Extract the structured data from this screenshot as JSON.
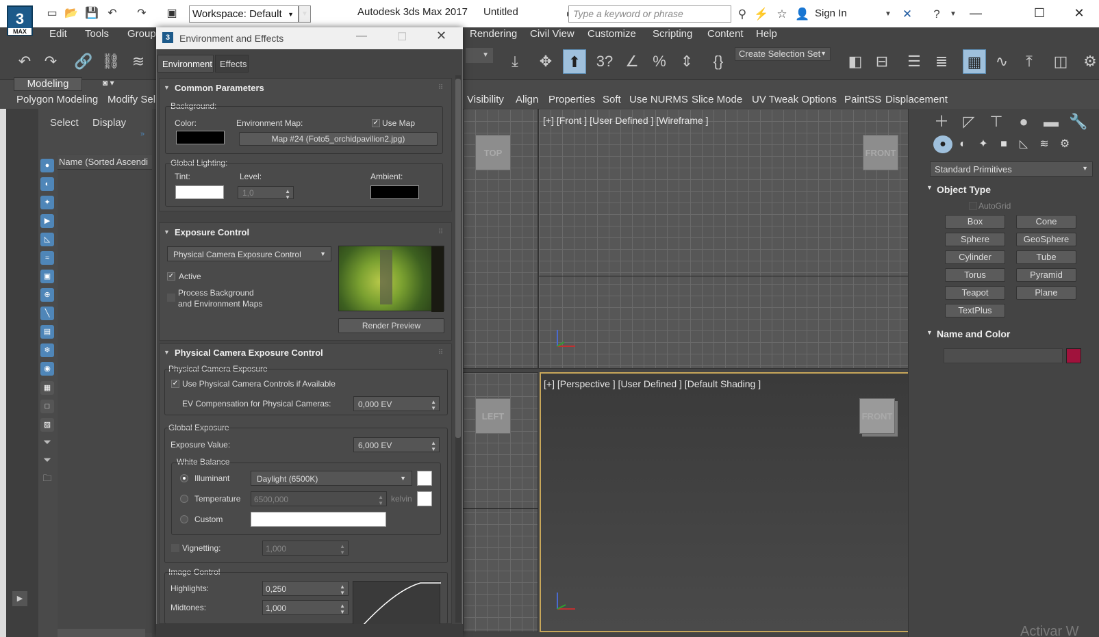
{
  "title_bar": {
    "app_logo": "3",
    "app_logo_sub": "MAX",
    "workspace": "Workspace: Default",
    "app_title": "Autodesk 3ds Max 2017",
    "doc_title": "Untitled",
    "search_placeholder": "Type a keyword or phrase",
    "sign_in": "Sign In"
  },
  "menus": [
    "Edit",
    "Tools",
    "Group",
    "Rendering",
    "Civil View",
    "Customize",
    "Scripting",
    "Content",
    "Help"
  ],
  "toolbar": {
    "selection_set": "Create Selection Set"
  },
  "ribbon": {
    "tab": "Modeling",
    "left_items": [
      "Polygon Modeling",
      "Modify Sel"
    ],
    "right_items": [
      "Visibility",
      "Align",
      "Properties",
      "Soft",
      "Use NURMS",
      "Slice Mode",
      "UV Tweak Options",
      "PaintSS",
      "Displacement"
    ]
  },
  "scene_explorer": {
    "tabs": [
      "Select",
      "Display"
    ],
    "column": "Name (Sorted Ascendi"
  },
  "viewports": {
    "top_right_label": "[+] [Front ] [User Defined ] [Wireframe ]",
    "bottom_right_label": "[+] [Perspective ] [User Defined ] [Default Shading ]",
    "cube_top": "TOP",
    "cube_front": "FRONT",
    "cube_left": "LEFT",
    "cube_persp": "FRONT"
  },
  "command_panel": {
    "dropdown": "Standard Primitives",
    "object_type": "Object Type",
    "autogrid": "AutoGrid",
    "buttons": [
      "Box",
      "Cone",
      "Sphere",
      "GeoSphere",
      "Cylinder",
      "Tube",
      "Torus",
      "Pyramid",
      "Teapot",
      "Plane",
      "TextPlus"
    ],
    "name_and_color": "Name and Color",
    "object_color": "#a0123c"
  },
  "dialog": {
    "title": "Environment and Effects",
    "tabs": [
      "Environment",
      "Effects"
    ],
    "common": {
      "header": "Common Parameters",
      "background": "Background:",
      "color": "Color:",
      "env_map": "Environment Map:",
      "use_map": "Use Map",
      "map_name": "Map #24 (Foto5_orchidpavilion2.jpg)",
      "global_lighting": "Global Lighting:",
      "tint": "Tint:",
      "level": "Level:",
      "level_value": "1,0",
      "ambient": "Ambient:"
    },
    "exposure": {
      "header": "Exposure Control",
      "dropdown": "Physical Camera Exposure Control",
      "active": "Active",
      "process_bg_1": "Process Background",
      "process_bg_2": "and Environment Maps",
      "render_preview": "Render Preview"
    },
    "pce": {
      "header": "Physical Camera Exposure Control",
      "group1": "Physical Camera Exposure",
      "use_controls": "Use Physical Camera Controls if Available",
      "ev_comp_label": "EV Compensation for Physical Cameras:",
      "ev_comp_value": "0,000 EV",
      "group2": "Global Exposure",
      "exposure_label": "Exposure Value:",
      "exposure_value": "6,000 EV",
      "white_balance": "White Balance",
      "illuminant": "Illuminant",
      "illuminant_value": "Daylight (6500K)",
      "temperature": "Temperature",
      "temperature_value": "6500,000",
      "kelvin": "kelvin",
      "custom": "Custom",
      "vignetting": "Vignetting:",
      "vignetting_value": "1,000",
      "group3": "Image Control",
      "highlights": "Highlights:",
      "highlights_value": "0,250",
      "midtones": "Midtones:",
      "midtones_value": "1,000"
    }
  },
  "watermark": "Activar W"
}
